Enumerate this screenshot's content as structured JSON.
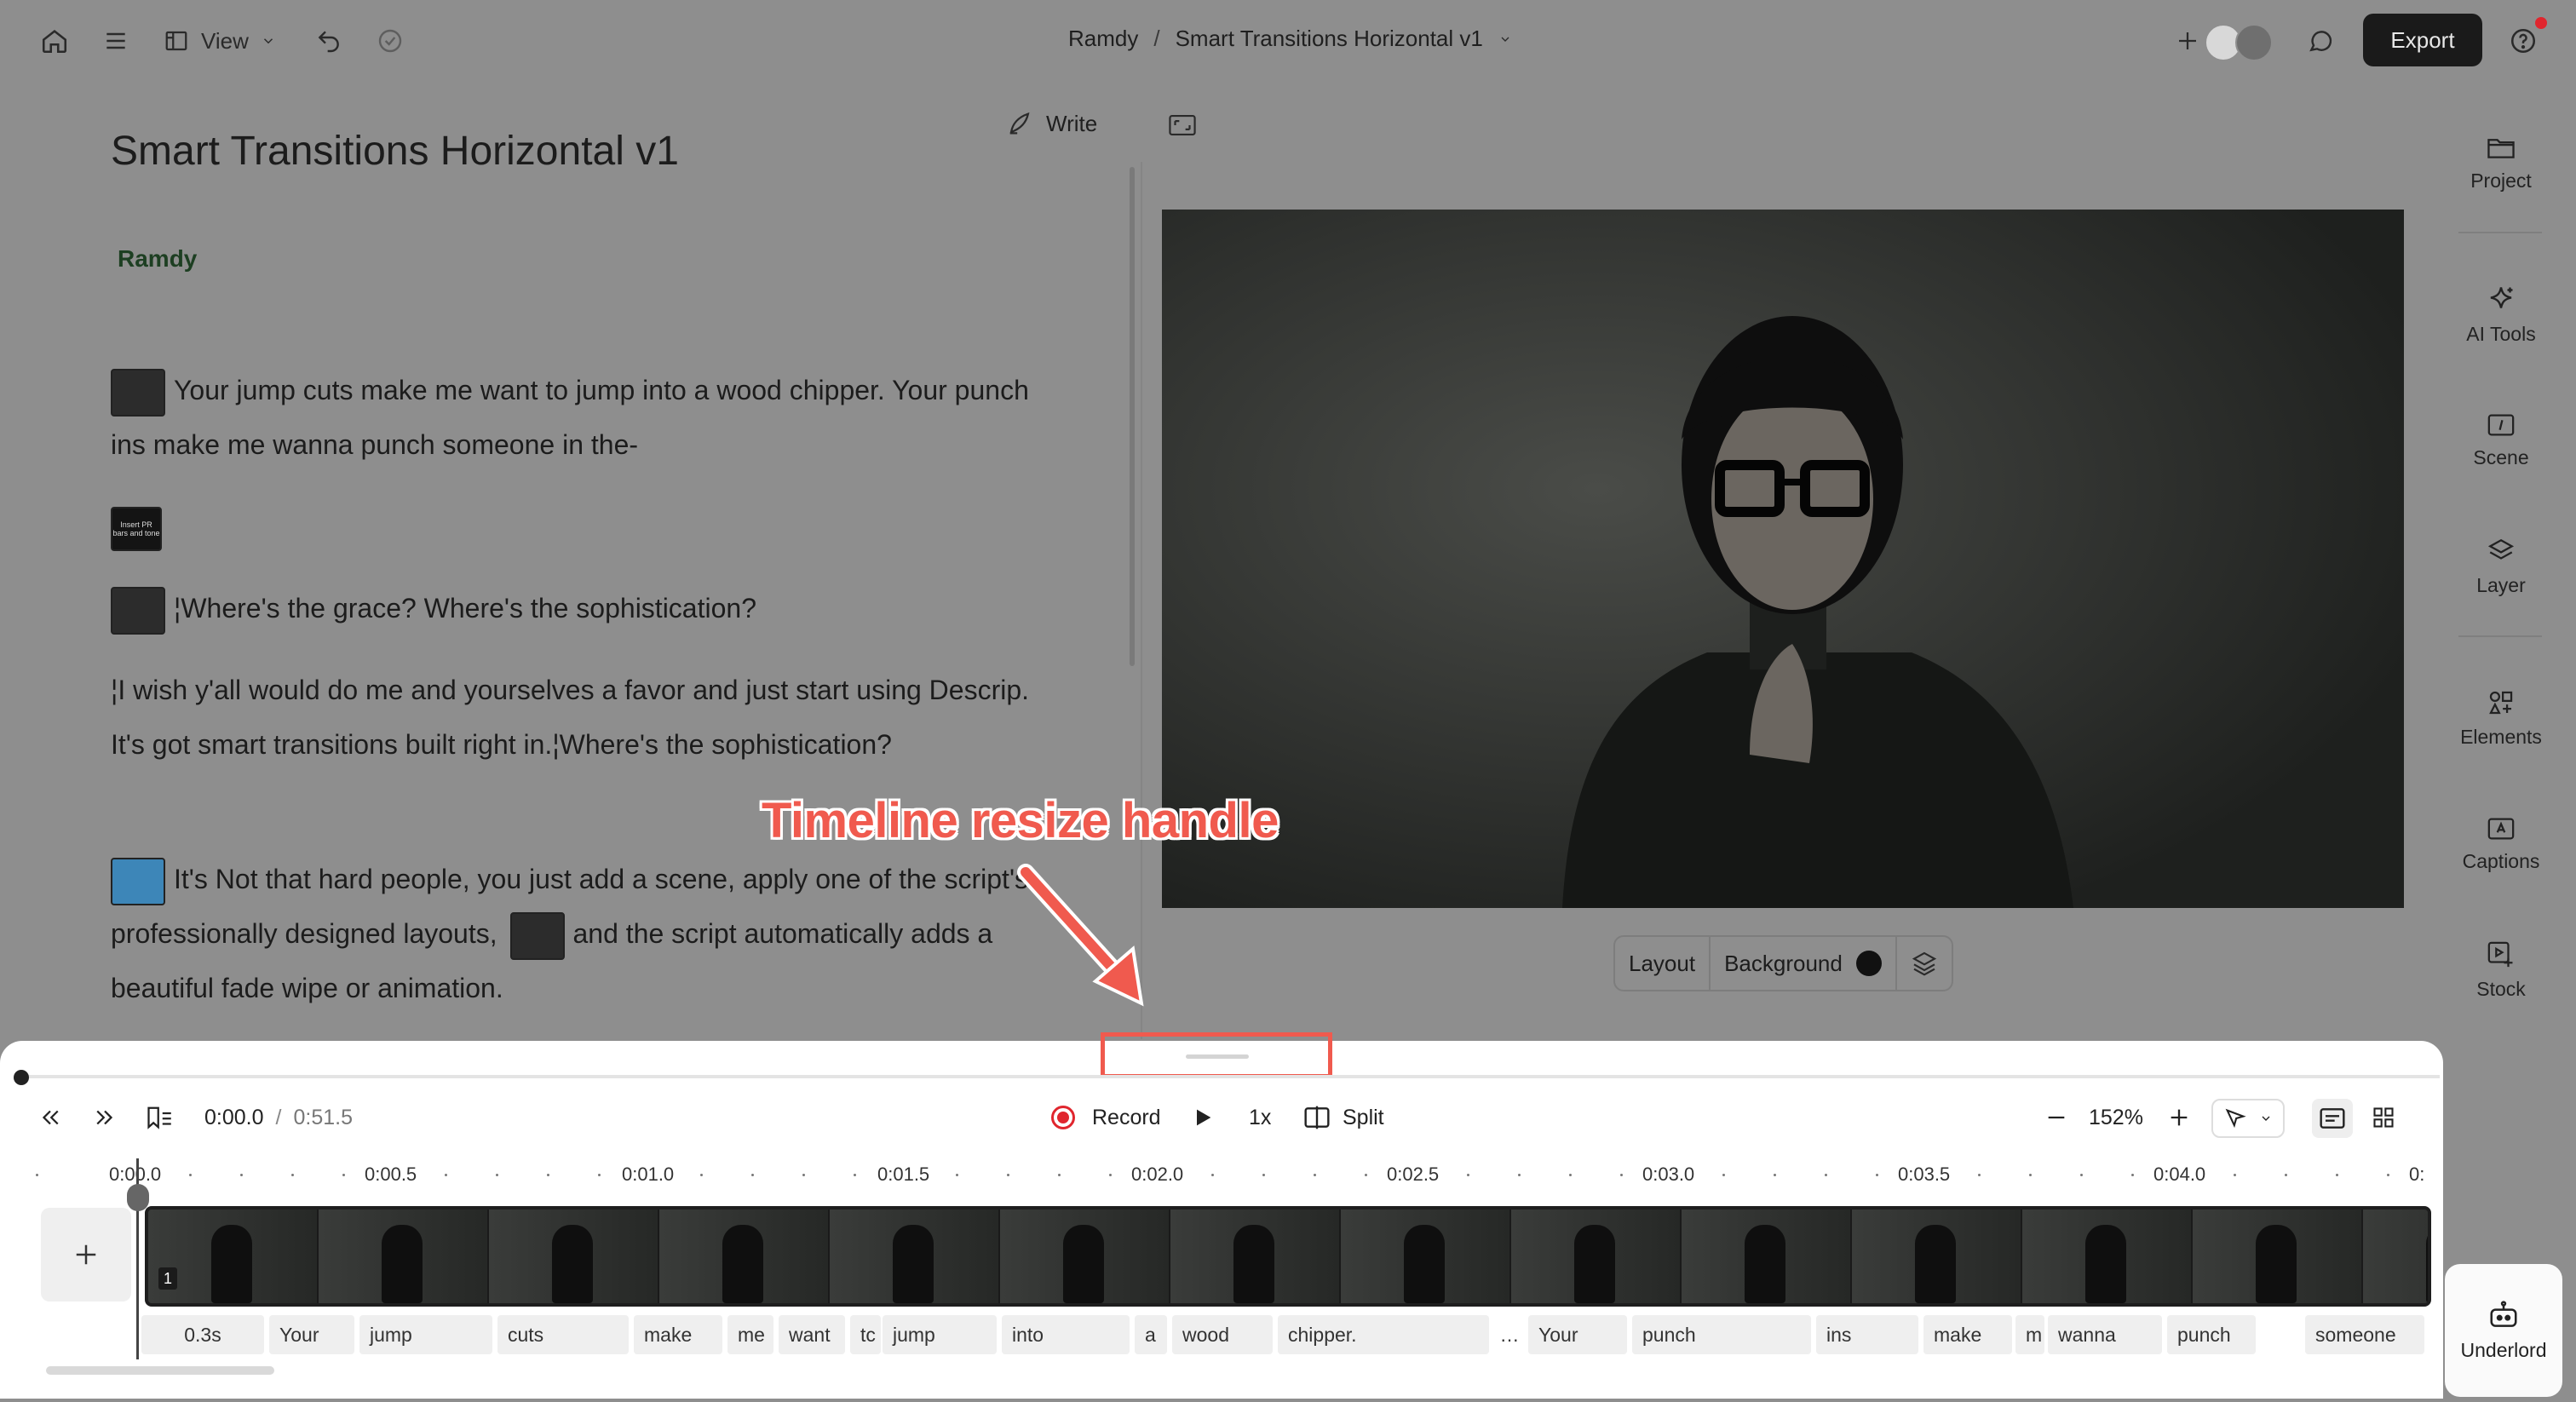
{
  "topbar": {
    "view_label": "View",
    "breadcrumb_owner": "Ramdy",
    "breadcrumb_sep": "/",
    "breadcrumb_project": "Smart Transitions Horizontal v1",
    "export_label": "Export"
  },
  "script": {
    "write_label": "Write",
    "title": "Smart Transitions Horizontal v1",
    "speaker": "Ramdy",
    "thumb_caption": "Insert PR bars and tone",
    "paragraphs": [
      "Your jump cuts make me want to jump into a wood chipper. Your punch ins make me wanna punch someone in the-",
      "¦Where's the grace? Where's the sophistication?",
      "¦I wish y'all would do me and yourselves a favor and just start using Descrip. It's got smart transitions built right in.¦Where's the sophistication?",
      "It's Not that hard people, you just add a scene, apply one of the script's professionally designed layouts,",
      "and the script automatically adds a beautiful fade wipe or animation."
    ]
  },
  "preview_controls": {
    "layout_label": "Layout",
    "background_label": "Background",
    "background_color": "#111111"
  },
  "sidebar": {
    "items": [
      {
        "label": "Project",
        "icon": "folder-icon"
      },
      {
        "label": "AI Tools",
        "icon": "sparkle-icon"
      },
      {
        "label": "Scene",
        "icon": "scene-icon"
      },
      {
        "label": "Layer",
        "icon": "layers-icon"
      },
      {
        "label": "Elements",
        "icon": "elements-icon"
      },
      {
        "label": "Captions",
        "icon": "captions-icon"
      },
      {
        "label": "Stock",
        "icon": "stock-icon"
      }
    ],
    "underlord_label": "Underlord"
  },
  "annotation": {
    "label": "Timeline resize handle",
    "color": "#f05a4e"
  },
  "timeline": {
    "current_time": "0:00.0",
    "time_sep": "/",
    "total_time": "0:51.5",
    "record_label": "Record",
    "speed_label": "1x",
    "split_label": "Split",
    "zoom_label": "152%",
    "clip_number": "1",
    "ruler_labels": [
      "0:00.0",
      "0:00.5",
      "0:01.0",
      "0:01.5",
      "0:02.0",
      "0:02.5",
      "0:03.0",
      "0:03.5",
      "0:04.0",
      "0:"
    ],
    "words": [
      "0.3s",
      "Your",
      "jump",
      "cuts",
      "make",
      "me",
      "want",
      "tc",
      "jump",
      "into",
      "a",
      "wood",
      "chipper.",
      "…",
      "Your",
      "punch",
      "ins",
      "make",
      "m",
      "wanna",
      "punch",
      "someone"
    ]
  }
}
